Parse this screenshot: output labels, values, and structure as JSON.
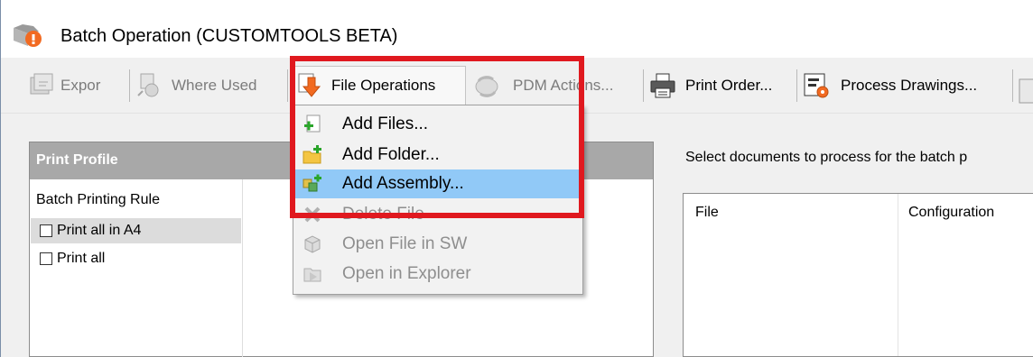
{
  "window": {
    "title": "Batch Operation (CUSTOMTOOLS BETA)"
  },
  "toolbar": {
    "items": [
      {
        "label": "Expor",
        "icon": "export-icon",
        "enabled": false
      },
      {
        "label": "Where Used",
        "icon": "where-used-icon",
        "enabled": false
      },
      {
        "label": "File Operations",
        "icon": "file-operations-icon",
        "enabled": true,
        "active": true
      },
      {
        "label": "PDM Actions...",
        "icon": "pdm-actions-icon",
        "enabled": false
      },
      {
        "label": "Print Order...",
        "icon": "printer-icon",
        "enabled": true
      },
      {
        "label": "Process Drawings...",
        "icon": "process-drawings-icon",
        "enabled": true
      }
    ]
  },
  "menu": {
    "items": [
      {
        "label": "Add Files...",
        "icon": "add-files-icon",
        "enabled": true,
        "hovered": false
      },
      {
        "label": "Add Folder...",
        "icon": "add-folder-icon",
        "enabled": true,
        "hovered": false
      },
      {
        "label": "Add Assembly...",
        "icon": "add-assembly-icon",
        "enabled": true,
        "hovered": true
      },
      {
        "label": "Delete File",
        "icon": "delete-icon",
        "enabled": false,
        "hovered": false
      },
      {
        "label": "Open File in SW",
        "icon": "open-in-sw-icon",
        "enabled": false,
        "hovered": false
      },
      {
        "label": "Open in Explorer",
        "icon": "open-in-explorer-icon",
        "enabled": false,
        "hovered": false
      }
    ]
  },
  "print_profile": {
    "title": "Print Profile",
    "column_header": "Batch Printing Rule",
    "rules": [
      {
        "label": "Print all in A4",
        "checked": false,
        "selected": true
      },
      {
        "label": "Print all",
        "checked": false,
        "selected": false
      }
    ]
  },
  "documents": {
    "instruction": "Select documents to process for the batch p",
    "columns": [
      "File",
      "Configuration"
    ]
  },
  "colors": {
    "highlight": "#e0191f",
    "menu_hover": "#91c9f7",
    "header_gray": "#a8a8a8",
    "accent_orange": "#f26a21"
  }
}
